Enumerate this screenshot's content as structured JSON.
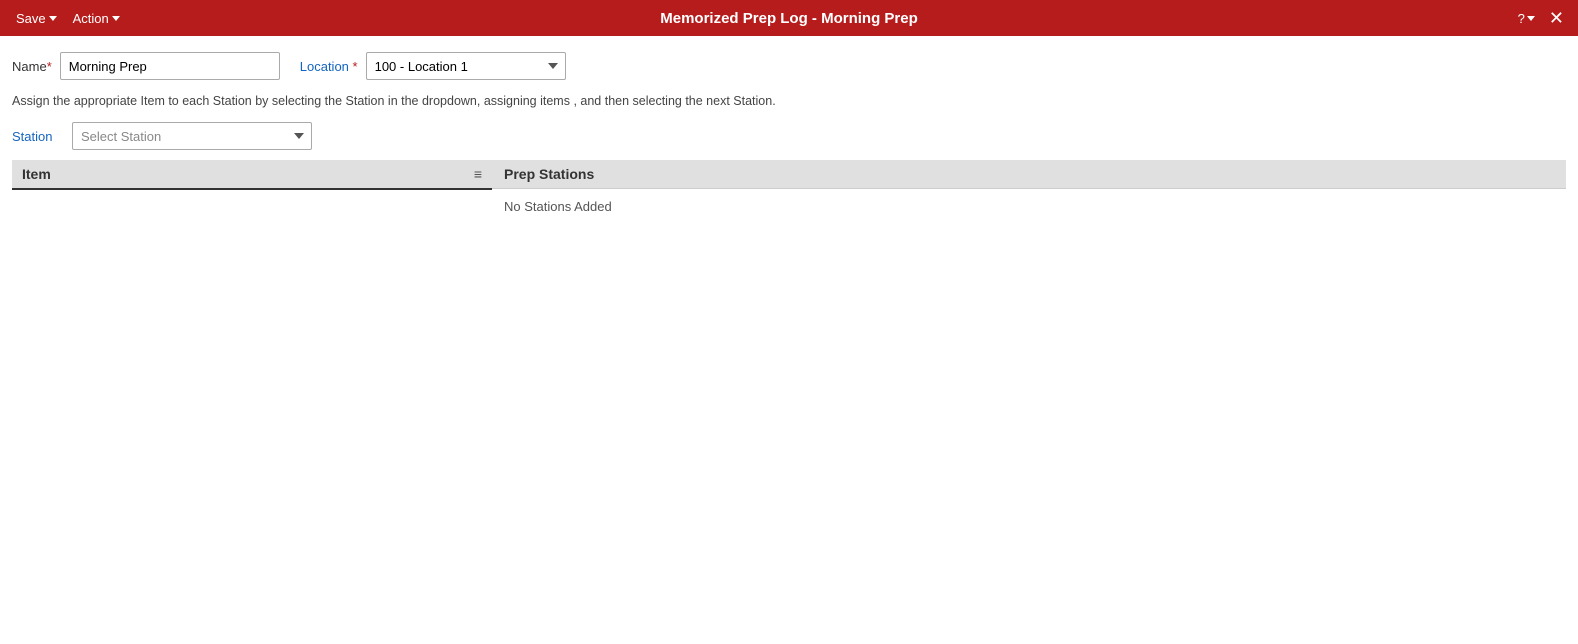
{
  "topbar": {
    "title": "Memorized Prep Log - Morning Prep",
    "save_label": "Save",
    "action_label": "Action",
    "help_label": "?",
    "close_label": "✕"
  },
  "form": {
    "name_label": "Name",
    "name_required": "*",
    "name_value": "Morning Prep",
    "location_label": "Location",
    "location_required": "*",
    "location_value": "100 - Location 1"
  },
  "instruction": "Assign the appropriate Item to each Station by selecting the Station in the dropdown, assigning items , and then selecting the next Station.",
  "station": {
    "label": "Station",
    "select_placeholder": "Select Station"
  },
  "item_panel": {
    "header": "Item",
    "filter_icon": "≡"
  },
  "prep_stations": {
    "header": "Prep Stations",
    "empty_message": "No Stations Added"
  }
}
